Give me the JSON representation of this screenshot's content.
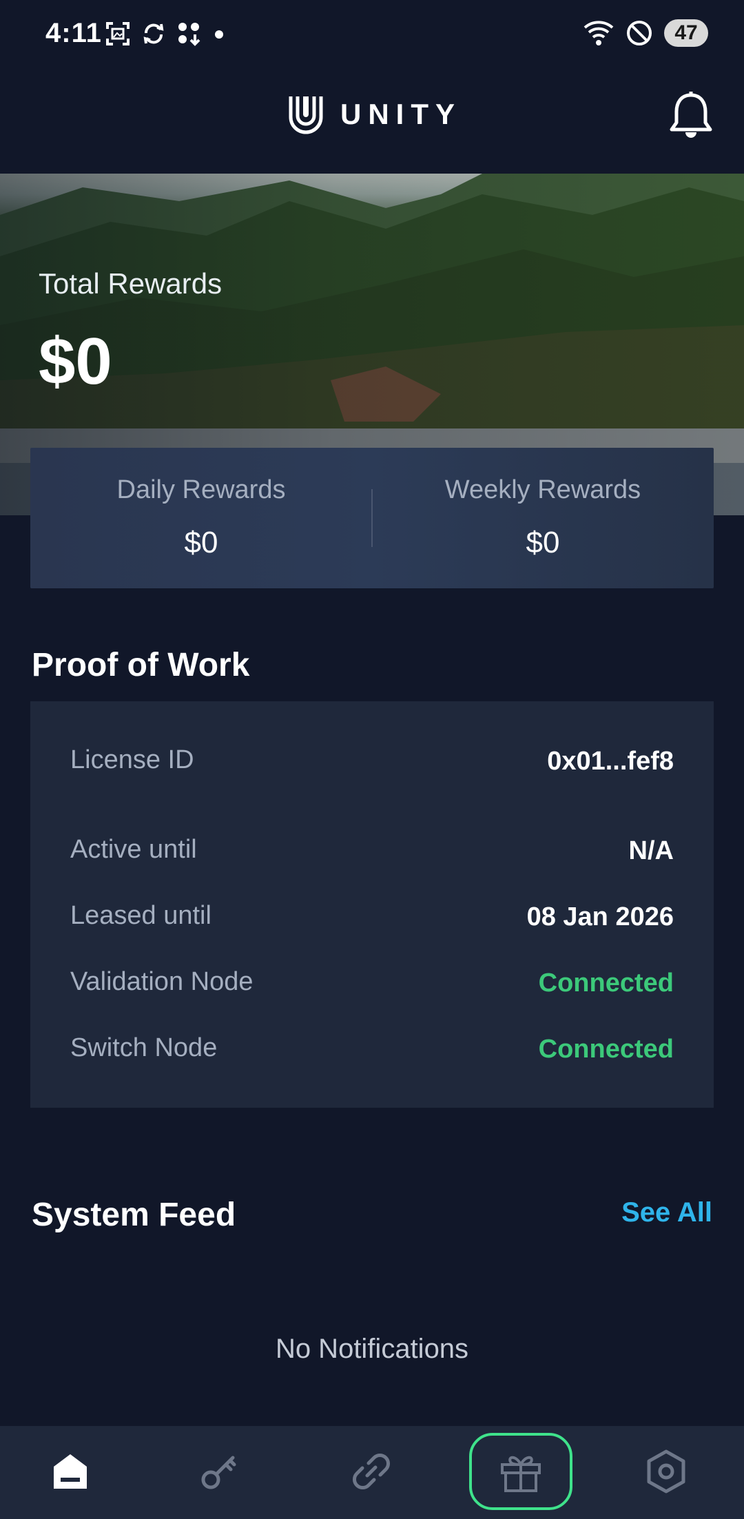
{
  "status_bar": {
    "time": "4:11",
    "battery": "47",
    "icons_left": [
      "screenshot-icon",
      "sync-icon",
      "apps-download-icon",
      "dot-icon"
    ],
    "icons_right": [
      "wifi-icon",
      "do-not-disturb-icon",
      "battery-icon"
    ]
  },
  "header": {
    "brand_name": "UNITY",
    "logo_icon": "unity-logo-icon",
    "bell_icon": "bell-icon"
  },
  "hero": {
    "total_label": "Total Rewards",
    "total_value": "$0"
  },
  "rewards": {
    "daily_label": "Daily Rewards",
    "daily_value": "$0",
    "weekly_label": "Weekly Rewards",
    "weekly_value": "$0"
  },
  "proof_of_work": {
    "title": "Proof of Work",
    "rows": [
      {
        "label": "License ID",
        "value": "0x01...fef8",
        "status": false
      },
      {
        "label": "Active until",
        "value": "N/A",
        "status": false
      },
      {
        "label": "Leased until",
        "value": "08 Jan 2026",
        "status": false
      },
      {
        "label": "Validation Node",
        "value": "Connected",
        "status": true
      },
      {
        "label": "Switch Node",
        "value": "Connected",
        "status": true
      }
    ]
  },
  "system_feed": {
    "title": "System Feed",
    "see_all": "See All",
    "empty_text": "No Notifications"
  },
  "bottom_nav": {
    "items": [
      "home-icon",
      "key-icon",
      "link-icon",
      "gift-icon",
      "settings-hex-icon"
    ],
    "highlighted": "gift-icon"
  },
  "colors": {
    "background": "#111729",
    "card": "#1f283b",
    "accent_green": "#3cc97a",
    "link_blue": "#2fb4ea",
    "nav_outline": "#3fe28b"
  }
}
